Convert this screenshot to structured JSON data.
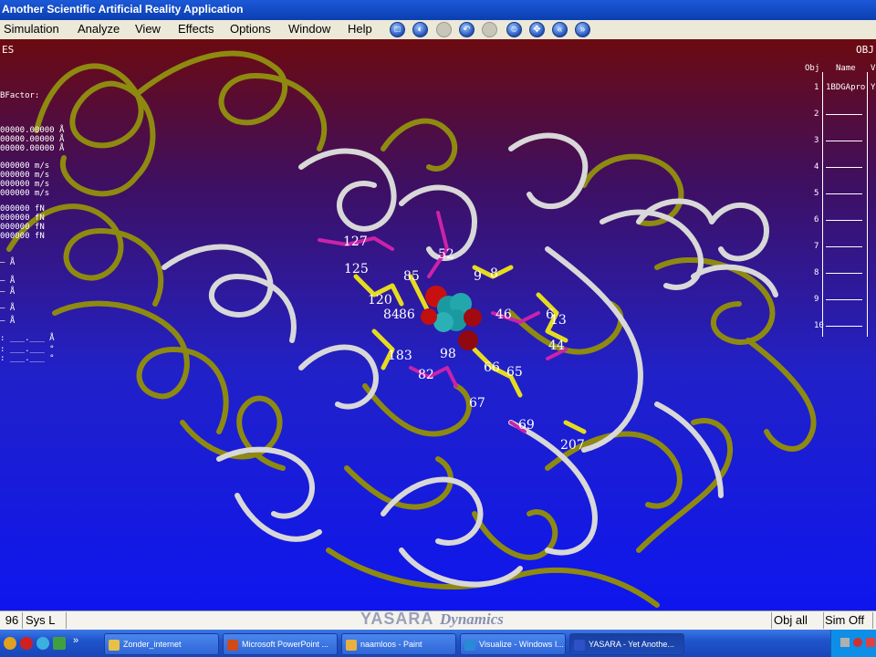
{
  "window": {
    "title": "Another Scientific Artificial Reality Application"
  },
  "menu": [
    "Simulation",
    "Analyze",
    "View",
    "Effects",
    "Options",
    "Window",
    "Help"
  ],
  "toolbar_icons": [
    "new-icon",
    "open-icon",
    "save-icon",
    "undo-icon",
    "redo-icon",
    "face-icon",
    "move-icon",
    "rewind-icon",
    "forward-icon"
  ],
  "left_panel": {
    "header": "ES",
    "bfactor_label": "BFactor:",
    "positions": [
      "00000.00000 Å",
      "00000.00000 Å",
      "00000.00000 Å"
    ],
    "velocities": [
      "000000 m/s",
      "000000 m/s",
      "000000 m/s",
      "000000 m/s"
    ],
    "forces": [
      "000000 fN",
      "000000 fN",
      "000000 fN",
      "000000 fN"
    ],
    "bond_rows": [
      "— Å",
      "— Å",
      "— Å",
      "— Å",
      "— Å"
    ],
    "misc_rows": [
      ": ___.___ Å",
      ": ___.___ °",
      ": ___.___ °"
    ]
  },
  "right_panel": {
    "header": "OBJ",
    "columns": [
      "Obj",
      "Name",
      "V"
    ],
    "rows": [
      {
        "num": "1",
        "name": "1BDGApro",
        "v": "Y"
      },
      {
        "num": "2",
        "name": "",
        "v": ""
      },
      {
        "num": "3",
        "name": "",
        "v": ""
      },
      {
        "num": "4",
        "name": "",
        "v": ""
      },
      {
        "num": "5",
        "name": "",
        "v": ""
      },
      {
        "num": "6",
        "name": "",
        "v": ""
      },
      {
        "num": "7",
        "name": "",
        "v": ""
      },
      {
        "num": "8",
        "name": "",
        "v": ""
      },
      {
        "num": "9",
        "name": "",
        "v": ""
      },
      {
        "num": "10",
        "name": "",
        "v": ""
      }
    ]
  },
  "residue_labels": [
    "127",
    "125",
    "85",
    "120",
    "84",
    "86",
    "52",
    "9",
    "8",
    "46",
    "6",
    "13",
    "44",
    "183",
    "98",
    "82",
    "66",
    "65",
    "67",
    "69",
    "207"
  ],
  "logo": {
    "yasara": "YASARA",
    "dynamics": "Dynamics"
  },
  "statusbar": {
    "left_num": "96",
    "sys": "Sys L",
    "obj": "Obj  all",
    "sim": "Sim Off"
  },
  "taskbar": {
    "tasks": [
      {
        "label": "Zonder_internet",
        "icon_color": "#e8c048"
      },
      {
        "label": "Microsoft PowerPoint ...",
        "icon_color": "#d04a1a"
      },
      {
        "label": "naamloos - Paint",
        "icon_color": "#e8b040"
      },
      {
        "label": "Visualize - Windows I...",
        "icon_color": "#2a8ad8"
      },
      {
        "label": "YASARA - Yet Anothe...",
        "icon_color": "#3050c8"
      }
    ],
    "active_task": "YASARA - Yet Anothe..."
  }
}
